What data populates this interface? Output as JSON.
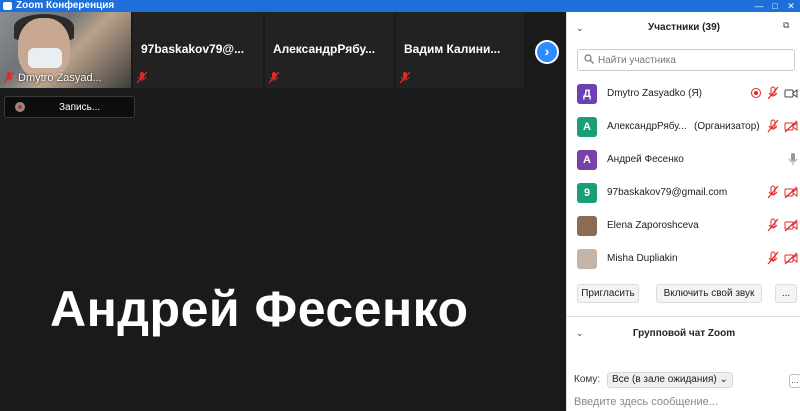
{
  "window": {
    "title": "Zoom Конференция",
    "minimize": "—",
    "maximize": "□",
    "close": "✕"
  },
  "thumbnails": [
    {
      "name": "Dmytro Zasyad...",
      "has_video": true,
      "muted": true
    },
    {
      "name": "97baskakov79@...",
      "has_video": false,
      "muted": true
    },
    {
      "name": "АлександрРябу...",
      "has_video": false,
      "muted": true
    },
    {
      "name": "Вадим  Калини...",
      "has_video": false,
      "muted": true
    }
  ],
  "next_page_icon": "chevron-right-icon",
  "recording": {
    "label": "Запись..."
  },
  "active_speaker": "Андрей Фесенко",
  "participants_panel": {
    "title": "Участники (39)",
    "collapse_glyph": "⌄",
    "popout_glyph": "⧉",
    "search_placeholder": "Найти участника",
    "participants": [
      {
        "initial": "Д",
        "color": "#6c3fb5",
        "name": "Dmytro Zasyadko (Я)",
        "role": "",
        "recording": true,
        "mic": "muted",
        "video": "on"
      },
      {
        "initial": "А",
        "color": "#1a9e77",
        "name": "АлександрРябу...",
        "role": "(Организатор)",
        "recording": false,
        "mic": "muted",
        "video": "off"
      },
      {
        "initial": "А",
        "color": "#7b3fa8",
        "name": "Андрей Фесенко",
        "role": "",
        "recording": false,
        "mic": "speaking",
        "video": "none"
      },
      {
        "initial": "9",
        "color": "#1a9e77",
        "name": "97baskakov79@gmail.com",
        "role": "",
        "recording": false,
        "mic": "muted",
        "video": "off"
      },
      {
        "initial": "",
        "color": "#8d6a52",
        "name": "Elena Zaporoshceva",
        "role": "",
        "recording": false,
        "mic": "muted",
        "video": "off"
      },
      {
        "initial": "",
        "color": "#c4b5a6",
        "name": "Misha Dupliakin",
        "role": "",
        "recording": false,
        "mic": "muted",
        "video": "off"
      }
    ],
    "invite_label": "Пригласить",
    "unmute_label": "Включить свой звук",
    "more_label": "..."
  },
  "chat": {
    "title": "Групповой чат Zoom",
    "collapse_glyph": "⌄",
    "to_label": "Кому:",
    "to_value": "Все (в зале ожидания) ⌄",
    "more_label": "...",
    "input_placeholder": "Введите здесь сообщение..."
  }
}
